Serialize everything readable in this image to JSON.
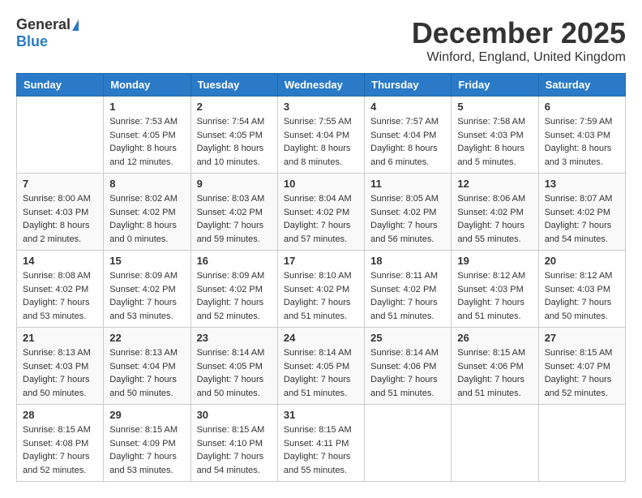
{
  "logo": {
    "general": "General",
    "blue": "Blue"
  },
  "header": {
    "month": "December 2025",
    "location": "Winford, England, United Kingdom"
  },
  "days_of_week": [
    "Sunday",
    "Monday",
    "Tuesday",
    "Wednesday",
    "Thursday",
    "Friday",
    "Saturday"
  ],
  "weeks": [
    [
      {
        "day": "",
        "info": ""
      },
      {
        "day": "1",
        "info": "Sunrise: 7:53 AM\nSunset: 4:05 PM\nDaylight: 8 hours\nand 12 minutes."
      },
      {
        "day": "2",
        "info": "Sunrise: 7:54 AM\nSunset: 4:05 PM\nDaylight: 8 hours\nand 10 minutes."
      },
      {
        "day": "3",
        "info": "Sunrise: 7:55 AM\nSunset: 4:04 PM\nDaylight: 8 hours\nand 8 minutes."
      },
      {
        "day": "4",
        "info": "Sunrise: 7:57 AM\nSunset: 4:04 PM\nDaylight: 8 hours\nand 6 minutes."
      },
      {
        "day": "5",
        "info": "Sunrise: 7:58 AM\nSunset: 4:03 PM\nDaylight: 8 hours\nand 5 minutes."
      },
      {
        "day": "6",
        "info": "Sunrise: 7:59 AM\nSunset: 4:03 PM\nDaylight: 8 hours\nand 3 minutes."
      }
    ],
    [
      {
        "day": "7",
        "info": "Sunrise: 8:00 AM\nSunset: 4:03 PM\nDaylight: 8 hours\nand 2 minutes."
      },
      {
        "day": "8",
        "info": "Sunrise: 8:02 AM\nSunset: 4:02 PM\nDaylight: 8 hours\nand 0 minutes."
      },
      {
        "day": "9",
        "info": "Sunrise: 8:03 AM\nSunset: 4:02 PM\nDaylight: 7 hours\nand 59 minutes."
      },
      {
        "day": "10",
        "info": "Sunrise: 8:04 AM\nSunset: 4:02 PM\nDaylight: 7 hours\nand 57 minutes."
      },
      {
        "day": "11",
        "info": "Sunrise: 8:05 AM\nSunset: 4:02 PM\nDaylight: 7 hours\nand 56 minutes."
      },
      {
        "day": "12",
        "info": "Sunrise: 8:06 AM\nSunset: 4:02 PM\nDaylight: 7 hours\nand 55 minutes."
      },
      {
        "day": "13",
        "info": "Sunrise: 8:07 AM\nSunset: 4:02 PM\nDaylight: 7 hours\nand 54 minutes."
      }
    ],
    [
      {
        "day": "14",
        "info": "Sunrise: 8:08 AM\nSunset: 4:02 PM\nDaylight: 7 hours\nand 53 minutes."
      },
      {
        "day": "15",
        "info": "Sunrise: 8:09 AM\nSunset: 4:02 PM\nDaylight: 7 hours\nand 53 minutes."
      },
      {
        "day": "16",
        "info": "Sunrise: 8:09 AM\nSunset: 4:02 PM\nDaylight: 7 hours\nand 52 minutes."
      },
      {
        "day": "17",
        "info": "Sunrise: 8:10 AM\nSunset: 4:02 PM\nDaylight: 7 hours\nand 51 minutes."
      },
      {
        "day": "18",
        "info": "Sunrise: 8:11 AM\nSunset: 4:02 PM\nDaylight: 7 hours\nand 51 minutes."
      },
      {
        "day": "19",
        "info": "Sunrise: 8:12 AM\nSunset: 4:03 PM\nDaylight: 7 hours\nand 51 minutes."
      },
      {
        "day": "20",
        "info": "Sunrise: 8:12 AM\nSunset: 4:03 PM\nDaylight: 7 hours\nand 50 minutes."
      }
    ],
    [
      {
        "day": "21",
        "info": "Sunrise: 8:13 AM\nSunset: 4:03 PM\nDaylight: 7 hours\nand 50 minutes."
      },
      {
        "day": "22",
        "info": "Sunrise: 8:13 AM\nSunset: 4:04 PM\nDaylight: 7 hours\nand 50 minutes."
      },
      {
        "day": "23",
        "info": "Sunrise: 8:14 AM\nSunset: 4:05 PM\nDaylight: 7 hours\nand 50 minutes."
      },
      {
        "day": "24",
        "info": "Sunrise: 8:14 AM\nSunset: 4:05 PM\nDaylight: 7 hours\nand 51 minutes."
      },
      {
        "day": "25",
        "info": "Sunrise: 8:14 AM\nSunset: 4:06 PM\nDaylight: 7 hours\nand 51 minutes."
      },
      {
        "day": "26",
        "info": "Sunrise: 8:15 AM\nSunset: 4:06 PM\nDaylight: 7 hours\nand 51 minutes."
      },
      {
        "day": "27",
        "info": "Sunrise: 8:15 AM\nSunset: 4:07 PM\nDaylight: 7 hours\nand 52 minutes."
      }
    ],
    [
      {
        "day": "28",
        "info": "Sunrise: 8:15 AM\nSunset: 4:08 PM\nDaylight: 7 hours\nand 52 minutes."
      },
      {
        "day": "29",
        "info": "Sunrise: 8:15 AM\nSunset: 4:09 PM\nDaylight: 7 hours\nand 53 minutes."
      },
      {
        "day": "30",
        "info": "Sunrise: 8:15 AM\nSunset: 4:10 PM\nDaylight: 7 hours\nand 54 minutes."
      },
      {
        "day": "31",
        "info": "Sunrise: 8:15 AM\nSunset: 4:11 PM\nDaylight: 7 hours\nand 55 minutes."
      },
      {
        "day": "",
        "info": ""
      },
      {
        "day": "",
        "info": ""
      },
      {
        "day": "",
        "info": ""
      }
    ]
  ]
}
